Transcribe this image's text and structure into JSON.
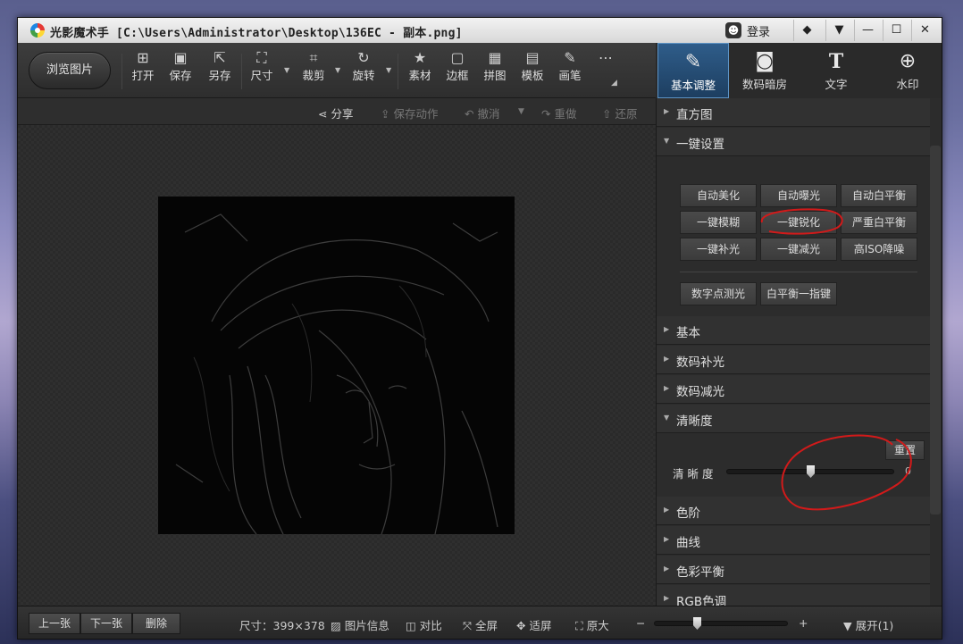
{
  "window": {
    "app_title": "光影魔术手 [C:\\Users\\Administrator\\Desktop\\136EC - 副本.png]",
    "login_label": "登录",
    "controls": [
      "◆",
      "▼",
      "—",
      "☐",
      "✕"
    ]
  },
  "toolbar": {
    "browse_label": "浏览图片",
    "items": [
      {
        "label": "打开",
        "icon": "image-open-icon",
        "glyph": "⊞"
      },
      {
        "label": "保存",
        "icon": "save-icon",
        "glyph": "▣"
      },
      {
        "label": "另存",
        "icon": "save-as-icon",
        "glyph": "⇱"
      },
      {
        "label": "尺寸",
        "icon": "resize-icon",
        "glyph": "⛶"
      },
      {
        "label": "裁剪",
        "icon": "crop-icon",
        "glyph": "⌗"
      },
      {
        "label": "旋转",
        "icon": "rotate-icon",
        "glyph": "↻"
      },
      {
        "label": "素材",
        "icon": "material-icon",
        "glyph": "★"
      },
      {
        "label": "边框",
        "icon": "frame-icon",
        "glyph": "▢"
      },
      {
        "label": "拼图",
        "icon": "collage-icon",
        "glyph": "▦"
      },
      {
        "label": "模板",
        "icon": "template-icon",
        "glyph": "▤"
      },
      {
        "label": "画笔",
        "icon": "brush-icon",
        "glyph": "✎"
      },
      {
        "label": "",
        "icon": "more-icon",
        "glyph": "⋯"
      }
    ]
  },
  "tabs": [
    {
      "label": "基本调整",
      "icon": "edit-adjust-icon",
      "glyph": "✎"
    },
    {
      "label": "数码暗房",
      "icon": "camera-icon",
      "glyph": "◙"
    },
    {
      "label": "文字",
      "icon": "text-icon",
      "glyph": "T"
    },
    {
      "label": "水印",
      "icon": "watermark-icon",
      "glyph": "⊕"
    }
  ],
  "actions": {
    "share": "分享",
    "save_action": "保存动作",
    "undo": "撤消",
    "redo": "重做",
    "restore": "还原"
  },
  "panel": {
    "histogram": "直方图",
    "one_click": "一键设置",
    "buttons_row1": [
      "自动美化",
      "自动曝光",
      "自动白平衡"
    ],
    "buttons_row2": [
      "一键模糊",
      "一键锐化",
      "严重白平衡"
    ],
    "buttons_row3": [
      "一键补光",
      "一键减光",
      "高ISO降噪"
    ],
    "buttons_row4": [
      "数字点测光",
      "白平衡一指键"
    ],
    "basic": "基本",
    "fill_light": "数码补光",
    "reduce_light": "数码减光",
    "clarity": "清晰度",
    "reset": "重置",
    "clarity_label": "清 晰 度",
    "clarity_value": "0",
    "levels": "色阶",
    "curves": "曲线",
    "color_balance": "色彩平衡",
    "rgb": "RGB色调"
  },
  "status": {
    "prev": "上一张",
    "next": "下一张",
    "delete": "删除",
    "size": "尺寸：399×378",
    "info": "图片信息",
    "compare": "对比",
    "fullscreen": "全屏",
    "fit": "适屏",
    "actual": "原大",
    "minus": "−",
    "plus": "+",
    "expand": "展开(1)"
  }
}
